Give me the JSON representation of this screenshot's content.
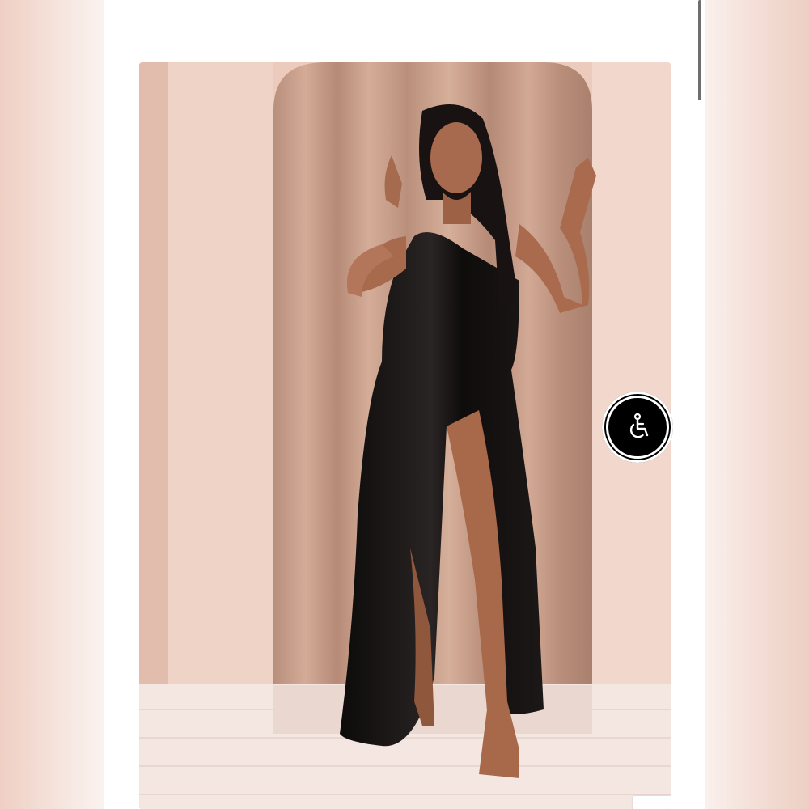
{
  "product": {
    "image_alt": "",
    "zoom_icon": "search-icon",
    "accessibility_icon": "wheelchair-icon"
  },
  "colors": {
    "wall": "#eccbbd",
    "curtain": "#c9a08c",
    "dress": "#141010",
    "accessibility_button": "#000000"
  }
}
